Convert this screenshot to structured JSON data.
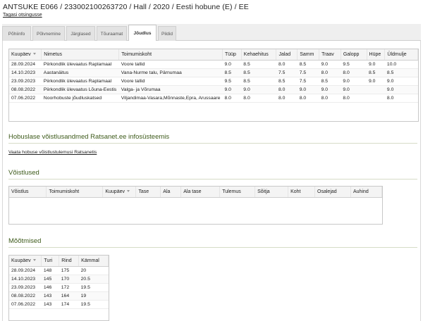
{
  "header": {
    "title": "ANTSUKE E066 / 233002100263720 / Hall / 2020 / Eesti hobune (E) / EE",
    "back_link": "Tagasi otsingusse"
  },
  "tabs": [
    {
      "label": "Põhiinfo",
      "active": false
    },
    {
      "label": "Põlvnemine",
      "active": false
    },
    {
      "label": "Järglased",
      "active": false
    },
    {
      "label": "Tõuraamat",
      "active": false
    },
    {
      "label": "Jõudlus",
      "active": true
    },
    {
      "label": "Pildid",
      "active": false
    }
  ],
  "performance": {
    "columns": [
      "Kuupäev",
      "Nimetus",
      "Toimumiskoht",
      "Tüüp",
      "Kehaehitus",
      "Jalad",
      "Samm",
      "Traav",
      "Galopp",
      "Hüpe",
      "Üldmulje"
    ],
    "rows": [
      [
        "28.09.2024",
        "Piirkondlik ülevaatus Raplamaal",
        "Voore tallid",
        "9.0",
        "8.5",
        "8.0",
        "8.5",
        "9.0",
        "9.5",
        "9.0",
        "10.0"
      ],
      [
        "14.10.2023",
        "Aastanäitus",
        "Vana-Nurme talu, Pärnumaa",
        "8.5",
        "8.5",
        "7.5",
        "7.5",
        "8.0",
        "8.0",
        "8.5",
        "8.5"
      ],
      [
        "23.09.2023",
        "Piirkondlik ülevaatus Raplamaal",
        "Voore tallid",
        "9.5",
        "8.5",
        "8.5",
        "7.5",
        "8.5",
        "9.0",
        "9.0",
        "9.0"
      ],
      [
        "08.08.2022",
        "Piirkondlik ülevaatus Lõuna-Eestis",
        "Valga- ja Võrumaa",
        "9.0",
        "9.0",
        "8.0",
        "9.0",
        "9.0",
        "9.0",
        "",
        "9.0"
      ],
      [
        "07.06.2022",
        "Noorhobuste jõudluskatsed",
        "Viljandimaa-Vasara,Mõnnaste,Epra, Arussaare",
        "8.0",
        "8.0",
        "8.0",
        "8.0",
        "8.0",
        "8.0",
        "",
        "8.0"
      ]
    ]
  },
  "ratsanet": {
    "heading": "Hobuslase võistlusandmed Ratsanet.ee infosüsteemis",
    "link": "Vaata hobuse võistlustulemusi Ratsanetis"
  },
  "competitions": {
    "heading": "Võistlused",
    "columns": [
      "Võistlus",
      "Toimumiskoht",
      "Kuupäev",
      "Tase",
      "Ala",
      "Ala tase",
      "Tulemus",
      "Sõitja",
      "Koht",
      "Osalejad",
      "Auhind"
    ]
  },
  "measurements": {
    "heading": "Mõõtmised",
    "columns": [
      "Kuupäev",
      "Turi",
      "Rind",
      "Kämmal"
    ],
    "rows": [
      [
        "28.09.2024",
        "148",
        "175",
        "20"
      ],
      [
        "14.10.2023",
        "145",
        "170",
        "20.5"
      ],
      [
        "23.09.2023",
        "146",
        "172",
        "19.5"
      ],
      [
        "08.08.2022",
        "143",
        "164",
        "19"
      ],
      [
        "07.06.2022",
        "143",
        "174",
        "19.5"
      ]
    ]
  }
}
